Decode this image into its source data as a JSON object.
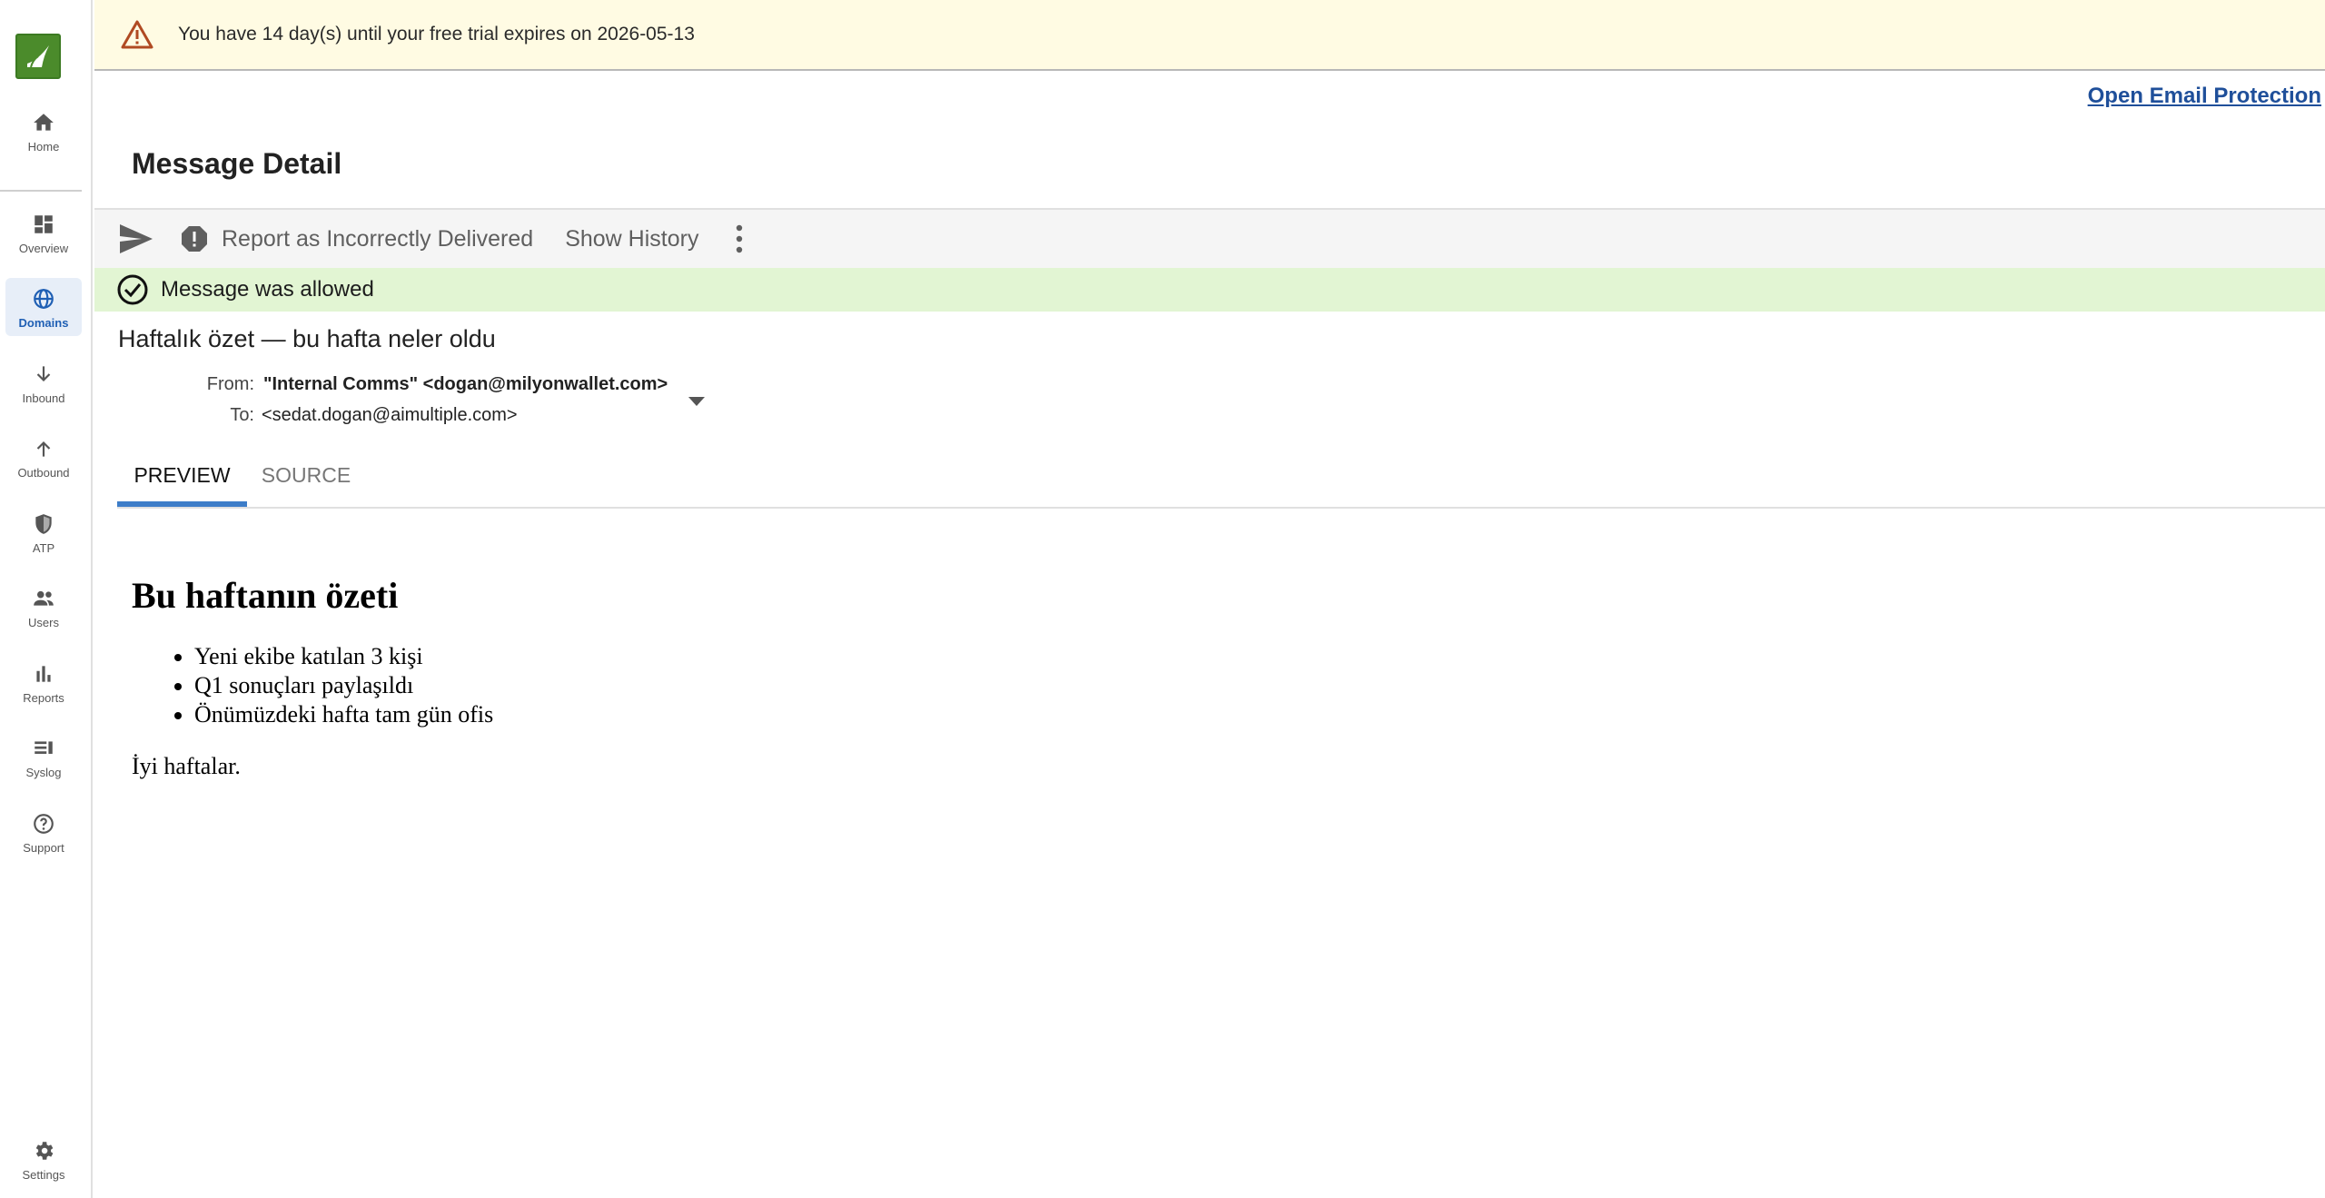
{
  "nav": {
    "home": "Home",
    "overview": "Overview",
    "domains": "Domains",
    "inbound": "Inbound",
    "outbound": "Outbound",
    "atp": "ATP",
    "users": "Users",
    "reports": "Reports",
    "syslog": "Syslog",
    "support": "Support",
    "settings": "Settings",
    "active": "Domains"
  },
  "banner": {
    "text": "You have 14 day(s) until your free trial expires on 2026-05-13"
  },
  "header": {
    "open_link": "Open Email Protection",
    "title": "Message Detail"
  },
  "toolbar": {
    "report": "Report as Incorrectly Delivered",
    "history": "Show History"
  },
  "status": {
    "text": "Message was allowed",
    "color": "#e2f5d3"
  },
  "message": {
    "subject": "Haftalık özet — bu hafta neler oldu",
    "from_label": "From:",
    "from_name": "\"Internal Comms\" <dogan@milyonwallet.com>",
    "to_label": "To:",
    "to_value": "<sedat.dogan@aimultiple.com>"
  },
  "tabs": {
    "preview": "PREVIEW",
    "source": "SOURCE",
    "active": "PREVIEW"
  },
  "body": {
    "heading": "Bu haftanın özeti",
    "items": [
      "Yeni ekibe katılan 3 kişi",
      "Q1 sonuçları paylaşıldı",
      "Önümüzdeki hafta tam gün ofis"
    ],
    "closing": "İyi haftalar."
  }
}
